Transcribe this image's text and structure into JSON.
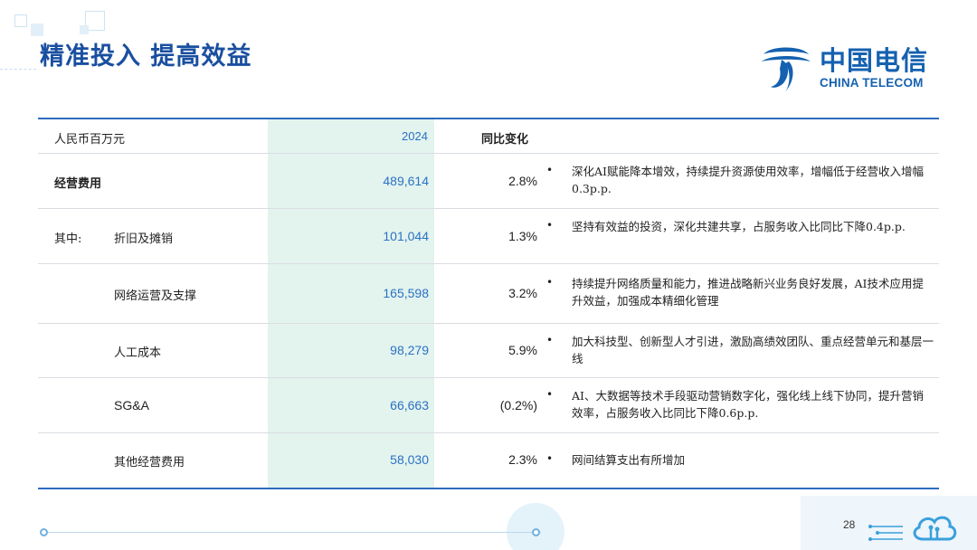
{
  "title": "精准投入 提高效益",
  "logo": {
    "cn": "中国电信",
    "en": "CHINA TELECOM"
  },
  "table": {
    "header": {
      "unit": "人民币百万元",
      "year": "2024",
      "yoy": "同比变化"
    },
    "rows": [
      {
        "group": "",
        "label": "经营费用",
        "value": "489,614",
        "change": "2.8%",
        "note": "深化AI赋能降本增效，持续提升资源使用效率，增幅低于经营收入增幅0.3p.p."
      },
      {
        "group": "其中:",
        "label": "折旧及摊销",
        "value": "101,044",
        "change": "1.3%",
        "note": "坚持有效益的投资，深化共建共享，占服务收入比同比下降0.4p.p."
      },
      {
        "group": "",
        "label": "网络运营及支撑",
        "value": "165,598",
        "change": "3.2%",
        "note": "持续提升网络质量和能力，推进战略新兴业务良好发展，AI技术应用提升效益，加强成本精细化管理"
      },
      {
        "group": "",
        "label": "人工成本",
        "value": "98,279",
        "change": "5.9%",
        "note": "加大科技型、创新型人才引进，激励高绩效团队、重点经营单元和基层一线"
      },
      {
        "group": "",
        "label": "SG&A",
        "value": "66,663",
        "change": "(0.2%)",
        "note": "AI、大数据等技术手段驱动营销数字化，强化线上线下协同，提升营销效率，占服务收入比同比下降0.6p.p."
      },
      {
        "group": "",
        "label": "其他经营费用",
        "value": "58,030",
        "change": "2.3%",
        "note": "网间结算支出有所增加"
      }
    ]
  },
  "page_number": "28",
  "bullet_symbol": "•",
  "colors": {
    "title": "#1a4fa0",
    "brand": "#1561b0",
    "value": "#2a72c4",
    "highlight_column": "#e3f3ee",
    "rule": "#2e6cc0"
  },
  "icons": {
    "logo_mark": "china-telecom-logo-icon",
    "cloud": "cloud-network-icon"
  }
}
